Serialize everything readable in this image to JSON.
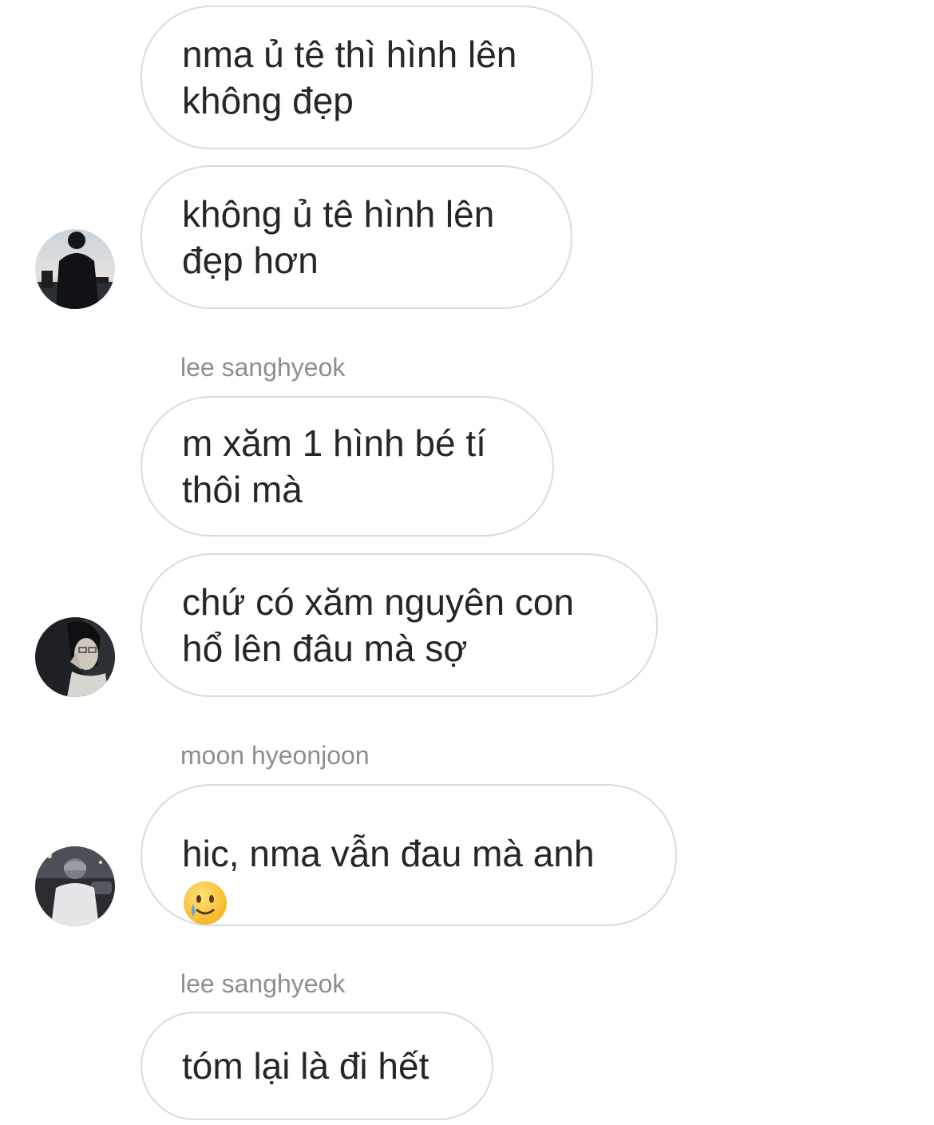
{
  "conversation": {
    "messages": [
      {
        "text": "nma ủ tê thì hình lên\nkhông đẹp"
      },
      {
        "text": "không ủ tê hình lên\nđẹp hơn"
      },
      {
        "text": "m xăm 1 hình bé tí\nthôi mà"
      },
      {
        "text": "chứ có xăm nguyên con\nhổ lên đâu mà sợ"
      },
      {
        "text": "hic, nma vẫn đau mà anh\n",
        "emoji": "crying-smile-emoji"
      },
      {
        "text": "tóm lại là đi hết"
      }
    ],
    "senders": [
      {
        "name": "lee sanghyeok"
      },
      {
        "name": "moon hyeonjoon"
      },
      {
        "name": "lee sanghyeok"
      }
    ],
    "avatars": [
      {
        "icon": "avatar-person-jacket"
      },
      {
        "icon": "avatar-person-glasses"
      },
      {
        "icon": "avatar-person-street"
      }
    ]
  }
}
